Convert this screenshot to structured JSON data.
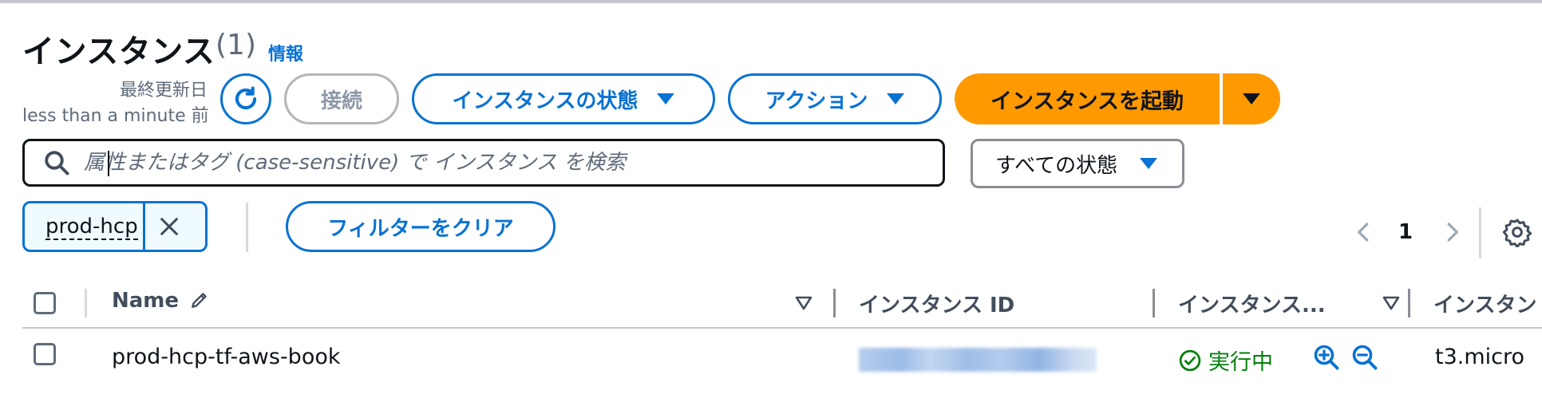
{
  "header": {
    "title": "インスタンス",
    "count": "(1)",
    "info_link": "情報",
    "last_updated_label": "最終更新日",
    "last_updated_value": "less than a minute 前"
  },
  "toolbar": {
    "connect_label": "接続",
    "instance_state_label": "インスタンスの状態",
    "actions_label": "アクション",
    "launch_label": "インスタンスを起動"
  },
  "search": {
    "placeholder": "属性またはタグ (case-sensitive) で インスタンス を検索",
    "status_filter": "すべての状態"
  },
  "filters": {
    "token": "prod-hcp",
    "clear_label": "フィルターをクリア"
  },
  "pagination": {
    "current_page": "1"
  },
  "table": {
    "columns": [
      "Name",
      "インスタンス ID",
      "インスタンス...",
      "インスタン"
    ],
    "rows": [
      {
        "name": "prod-hcp-tf-aws-book",
        "instance_id": "",
        "state": "実行中",
        "type": "t3.micro"
      }
    ]
  },
  "colors": {
    "primary": "#0972d3",
    "launch": "#ff9900",
    "running": "#037f0c",
    "text": "#0f141a"
  }
}
